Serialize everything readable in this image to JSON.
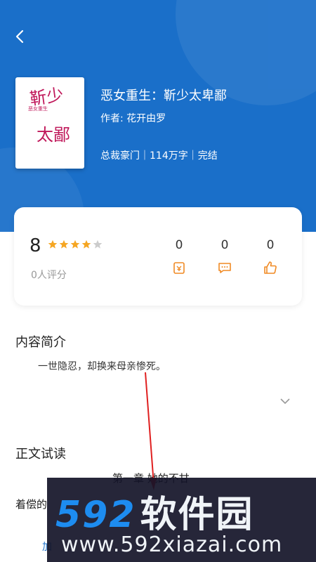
{
  "book": {
    "title": "恶女重生：靳少太卑鄙",
    "author": "作者: 花开由罗",
    "meta": "总裁豪门｜114万字｜完结",
    "cover_text_top": "靳少",
    "cover_text_bottom": "太鄙",
    "cover_subtitle": "恶女重生"
  },
  "rating": {
    "score": "8",
    "stars_filled": 4,
    "stars_total": 5,
    "count_text": "0人评分"
  },
  "stats": [
    {
      "value": "0",
      "icon": "reward-icon"
    },
    {
      "value": "0",
      "icon": "comment-icon"
    },
    {
      "value": "0",
      "icon": "like-icon"
    }
  ],
  "sections": {
    "intro_title": "内容简介",
    "intro_text": "一世隐忍，却换来母亲惨死。",
    "preview_title": "正文试读",
    "chapter_title": "第一章  她的不甘",
    "preview_text": "着偿的",
    "bottom_left": "加"
  },
  "watermark": {
    "brand_num": "592",
    "brand_cn": "软件园",
    "url": "www.592xiazai.com"
  },
  "colors": {
    "header_bg": "#1a6fc9",
    "star": "#f5a623",
    "star_empty": "#cccccc",
    "icon_orange": "#f08a24"
  }
}
